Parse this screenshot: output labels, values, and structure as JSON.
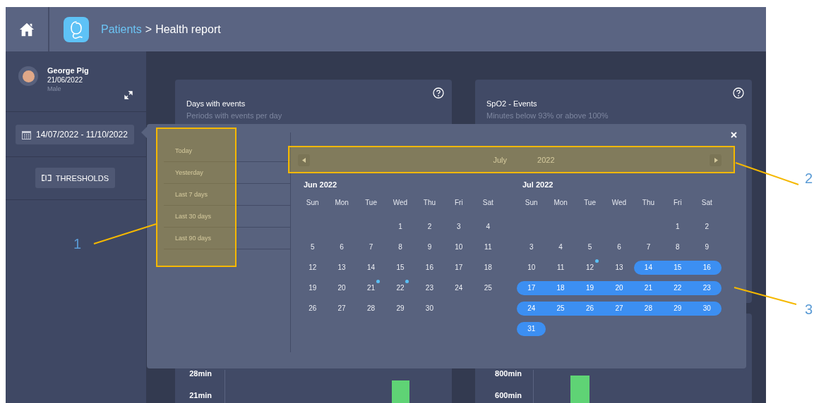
{
  "topbar": {
    "breadcrumb": [
      {
        "label": "Patients",
        "link": true
      },
      {
        "label": "Health report",
        "link": false
      }
    ],
    "separator": ">"
  },
  "patient": {
    "name": "George Pig",
    "birth_date": "21/06/2022",
    "sex": "Male"
  },
  "date_range": "14/07/2022 - 11/10/2022",
  "thresholds_button": "THRESHOLDS",
  "cards": [
    {
      "title": "Days with events",
      "subtitle": "Periods with events per day"
    },
    {
      "title": "SpO2 - Events",
      "subtitle": "Minutes below 93% or above 100%"
    }
  ],
  "chart_cards": [
    {
      "y_ticks": [
        "28min",
        "21min"
      ]
    },
    {
      "y_ticks": [
        "800min",
        "600min"
      ]
    }
  ],
  "date_picker": {
    "presets": [
      "Today",
      "Yesterday",
      "Last 7 days",
      "Last 30 days",
      "Last 90 days"
    ],
    "nav": {
      "month": "July",
      "year": "2022"
    },
    "months": [
      {
        "title": "Jun 2022",
        "weekdays": [
          "Sun",
          "Mon",
          "Tue",
          "Wed",
          "Thu",
          "Fri",
          "Sat"
        ],
        "weeks": [
          [
            {
              "kind": "blank"
            },
            {
              "kind": "blank"
            },
            {
              "kind": "blank"
            },
            {
              "kind": "day",
              "day": "1",
              "in_range": false,
              "event": false
            },
            {
              "kind": "day",
              "day": "2",
              "in_range": false,
              "event": false
            },
            {
              "kind": "day",
              "day": "3",
              "in_range": false,
              "event": false
            },
            {
              "kind": "day",
              "day": "4",
              "in_range": false,
              "event": false
            }
          ],
          [
            {
              "kind": "day",
              "day": "5",
              "in_range": false,
              "event": false
            },
            {
              "kind": "day",
              "day": "6",
              "in_range": false,
              "event": false
            },
            {
              "kind": "day",
              "day": "7",
              "in_range": false,
              "event": false
            },
            {
              "kind": "day",
              "day": "8",
              "in_range": false,
              "event": false
            },
            {
              "kind": "day",
              "day": "9",
              "in_range": false,
              "event": false
            },
            {
              "kind": "day",
              "day": "10",
              "in_range": false,
              "event": false
            },
            {
              "kind": "day",
              "day": "11",
              "in_range": false,
              "event": false
            }
          ],
          [
            {
              "kind": "day",
              "day": "12",
              "in_range": false,
              "event": false
            },
            {
              "kind": "day",
              "day": "13",
              "in_range": false,
              "event": false
            },
            {
              "kind": "day",
              "day": "14",
              "in_range": false,
              "event": false
            },
            {
              "kind": "day",
              "day": "15",
              "in_range": false,
              "event": false
            },
            {
              "kind": "day",
              "day": "16",
              "in_range": false,
              "event": false
            },
            {
              "kind": "day",
              "day": "17",
              "in_range": false,
              "event": false
            },
            {
              "kind": "day",
              "day": "18",
              "in_range": false,
              "event": false
            }
          ],
          [
            {
              "kind": "day",
              "day": "19",
              "in_range": false,
              "event": false
            },
            {
              "kind": "day",
              "day": "20",
              "in_range": false,
              "event": false
            },
            {
              "kind": "day",
              "day": "21",
              "in_range": false,
              "event": true
            },
            {
              "kind": "day",
              "day": "22",
              "in_range": false,
              "event": true
            },
            {
              "kind": "day",
              "day": "23",
              "in_range": false,
              "event": false
            },
            {
              "kind": "day",
              "day": "24",
              "in_range": false,
              "event": false
            },
            {
              "kind": "day",
              "day": "25",
              "in_range": false,
              "event": false
            }
          ],
          [
            {
              "kind": "day",
              "day": "26",
              "in_range": false,
              "event": false
            },
            {
              "kind": "day",
              "day": "27",
              "in_range": false,
              "event": false
            },
            {
              "kind": "day",
              "day": "28",
              "in_range": false,
              "event": false
            },
            {
              "kind": "day",
              "day": "29",
              "in_range": false,
              "event": false
            },
            {
              "kind": "day",
              "day": "30",
              "in_range": false,
              "event": false
            }
          ]
        ]
      },
      {
        "title": "Jul 2022",
        "weekdays": [
          "Sun",
          "Mon",
          "Tue",
          "Wed",
          "Thu",
          "Fri",
          "Sat"
        ],
        "weeks": [
          [
            {
              "kind": "blank"
            },
            {
              "kind": "blank"
            },
            {
              "kind": "blank"
            },
            {
              "kind": "blank"
            },
            {
              "kind": "blank"
            },
            {
              "kind": "day",
              "day": "1",
              "in_range": false,
              "event": false
            },
            {
              "kind": "day",
              "day": "2",
              "in_range": false,
              "event": false
            }
          ],
          [
            {
              "kind": "day",
              "day": "3",
              "in_range": false,
              "event": false
            },
            {
              "kind": "day",
              "day": "4",
              "in_range": false,
              "event": false
            },
            {
              "kind": "day",
              "day": "5",
              "in_range": false,
              "event": false
            },
            {
              "kind": "day",
              "day": "6",
              "in_range": false,
              "event": false
            },
            {
              "kind": "day",
              "day": "7",
              "in_range": false,
              "event": false
            },
            {
              "kind": "day",
              "day": "8",
              "in_range": false,
              "event": false
            },
            {
              "kind": "day",
              "day": "9",
              "in_range": false,
              "event": false
            }
          ],
          [
            {
              "kind": "day",
              "day": "10",
              "in_range": false,
              "event": false
            },
            {
              "kind": "day",
              "day": "11",
              "in_range": false,
              "event": false
            },
            {
              "kind": "day",
              "day": "12",
              "in_range": false,
              "event": true
            },
            {
              "kind": "day",
              "day": "13",
              "in_range": false,
              "event": false
            },
            {
              "kind": "day",
              "day": "14",
              "in_range": true,
              "event": false
            },
            {
              "kind": "day",
              "day": "15",
              "in_range": true,
              "event": false
            },
            {
              "kind": "day",
              "day": "16",
              "in_range": true,
              "event": false
            }
          ],
          [
            {
              "kind": "day",
              "day": "17",
              "in_range": true,
              "event": false
            },
            {
              "kind": "day",
              "day": "18",
              "in_range": true,
              "event": false
            },
            {
              "kind": "day",
              "day": "19",
              "in_range": true,
              "event": false
            },
            {
              "kind": "day",
              "day": "20",
              "in_range": true,
              "event": false
            },
            {
              "kind": "day",
              "day": "21",
              "in_range": true,
              "event": false
            },
            {
              "kind": "day",
              "day": "22",
              "in_range": true,
              "event": false
            },
            {
              "kind": "day",
              "day": "23",
              "in_range": true,
              "event": false
            }
          ],
          [
            {
              "kind": "day",
              "day": "24",
              "in_range": true,
              "event": false
            },
            {
              "kind": "day",
              "day": "25",
              "in_range": true,
              "event": false
            },
            {
              "kind": "day",
              "day": "26",
              "in_range": true,
              "event": false
            },
            {
              "kind": "day",
              "day": "27",
              "in_range": true,
              "event": false
            },
            {
              "kind": "day",
              "day": "28",
              "in_range": true,
              "event": false
            },
            {
              "kind": "day",
              "day": "29",
              "in_range": true,
              "event": false
            },
            {
              "kind": "day",
              "day": "30",
              "in_range": true,
              "event": false
            }
          ],
          [
            {
              "kind": "day",
              "day": "31",
              "in_range": true,
              "event": false
            }
          ]
        ]
      }
    ]
  },
  "callouts": [
    {
      "label": "1"
    },
    {
      "label": "2"
    },
    {
      "label": "3"
    }
  ]
}
